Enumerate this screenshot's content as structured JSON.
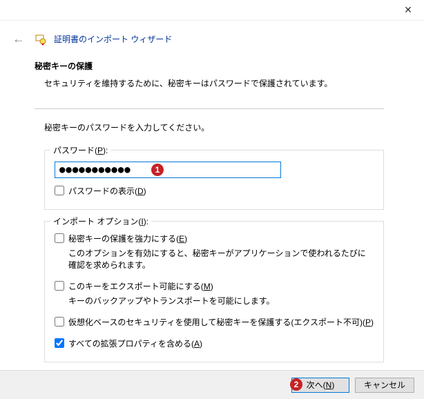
{
  "titlebar": {
    "close": "✕"
  },
  "header": {
    "back": "←",
    "wizard_title": "証明書のインポート ウィザード"
  },
  "section": {
    "heading": "秘密キーの保護",
    "desc": "セキュリティを維持するために、秘密キーはパスワードで保護されています。"
  },
  "instruction": "秘密キーのパスワードを入力してください。",
  "password_group": {
    "label": "パスワード(P):",
    "value": "●●●●●●●●●●●",
    "show_label": "パスワードの表示(D)",
    "badge": "1"
  },
  "options_group": {
    "label": "インポート オプション(I):",
    "opt1_label": "秘密キーの保護を強力にする(E)",
    "opt1_desc": "このオプションを有効にすると、秘密キーがアプリケーションで使われるたびに確認を求められます。",
    "opt2_label": "このキーをエクスポート可能にする(M)",
    "opt2_desc": "キーのバックアップやトランスポートを可能にします。",
    "opt3_label": "仮想化ベースのセキュリティを使用して秘密キーを保護する(エクスポート不可)(P)",
    "opt4_label": "すべての拡張プロパティを含める(A)"
  },
  "footer": {
    "next": "次へ(N)",
    "cancel": "キャンセル",
    "badge": "2"
  }
}
